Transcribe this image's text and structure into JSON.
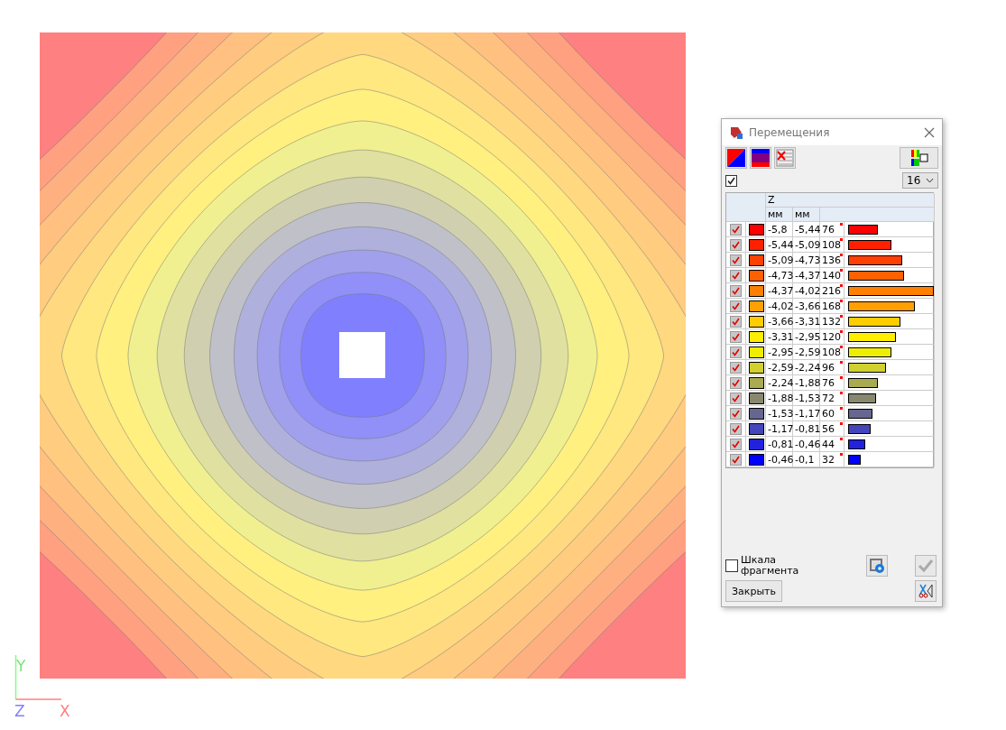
{
  "axes": {
    "y": "Y",
    "z": "Z",
    "x": "X"
  },
  "dialog": {
    "title": "Перемещения",
    "show_all_checked": true,
    "levels_select": "16",
    "component": "Z",
    "units": [
      "мм",
      "мм"
    ],
    "rows": [
      {
        "checked": true,
        "color": "#ff0000",
        "from": "-5,8",
        "to": "-5,44",
        "count": "76",
        "level": 0.35
      },
      {
        "checked": true,
        "color": "#ff2000",
        "from": "-5,44",
        "to": "-5,09",
        "count": "108",
        "level": 0.5
      },
      {
        "checked": true,
        "color": "#ff4000",
        "from": "-5,09",
        "to": "-4,73",
        "count": "136",
        "level": 0.63
      },
      {
        "checked": true,
        "color": "#ff6000",
        "from": "-4,73",
        "to": "-4,37",
        "count": "140",
        "level": 0.65
      },
      {
        "checked": true,
        "color": "#ff8000",
        "from": "-4,37",
        "to": "-4,02",
        "count": "216",
        "level": 1
      },
      {
        "checked": true,
        "color": "#ffa000",
        "from": "-4,02",
        "to": "-3,66",
        "count": "168",
        "level": 0.78
      },
      {
        "checked": true,
        "color": "#ffcc00",
        "from": "-3,66",
        "to": "-3,31",
        "count": "132",
        "level": 0.61
      },
      {
        "checked": true,
        "color": "#ffee00",
        "from": "-3,31",
        "to": "-2,95",
        "count": "120",
        "level": 0.56
      },
      {
        "checked": true,
        "color": "#eeee00",
        "from": "-2,95",
        "to": "-2,59",
        "count": "108",
        "level": 0.5
      },
      {
        "checked": true,
        "color": "#d0d030",
        "from": "-2,59",
        "to": "-2,24",
        "count": "96",
        "level": 0.44
      },
      {
        "checked": true,
        "color": "#aaaa50",
        "from": "-2,24",
        "to": "-1,88",
        "count": "76",
        "level": 0.35
      },
      {
        "checked": true,
        "color": "#888870",
        "from": "-1,88",
        "to": "-1,53",
        "count": "72",
        "level": 0.33
      },
      {
        "checked": true,
        "color": "#666690",
        "from": "-1,53",
        "to": "-1,17",
        "count": "60",
        "level": 0.28
      },
      {
        "checked": true,
        "color": "#4444bb",
        "from": "-1,17",
        "to": "-0,81",
        "count": "56",
        "level": 0.26
      },
      {
        "checked": true,
        "color": "#2222dd",
        "from": "-0,81",
        "to": "-0,46",
        "count": "44",
        "level": 0.2
      },
      {
        "checked": true,
        "color": "#0000ff",
        "from": "-0,46",
        "to": "-0,1",
        "count": "32",
        "level": 0.15
      }
    ],
    "scale_fragment": {
      "label": "Шкала фрагмента",
      "checked": false
    },
    "close_button": "Закрыть"
  }
}
